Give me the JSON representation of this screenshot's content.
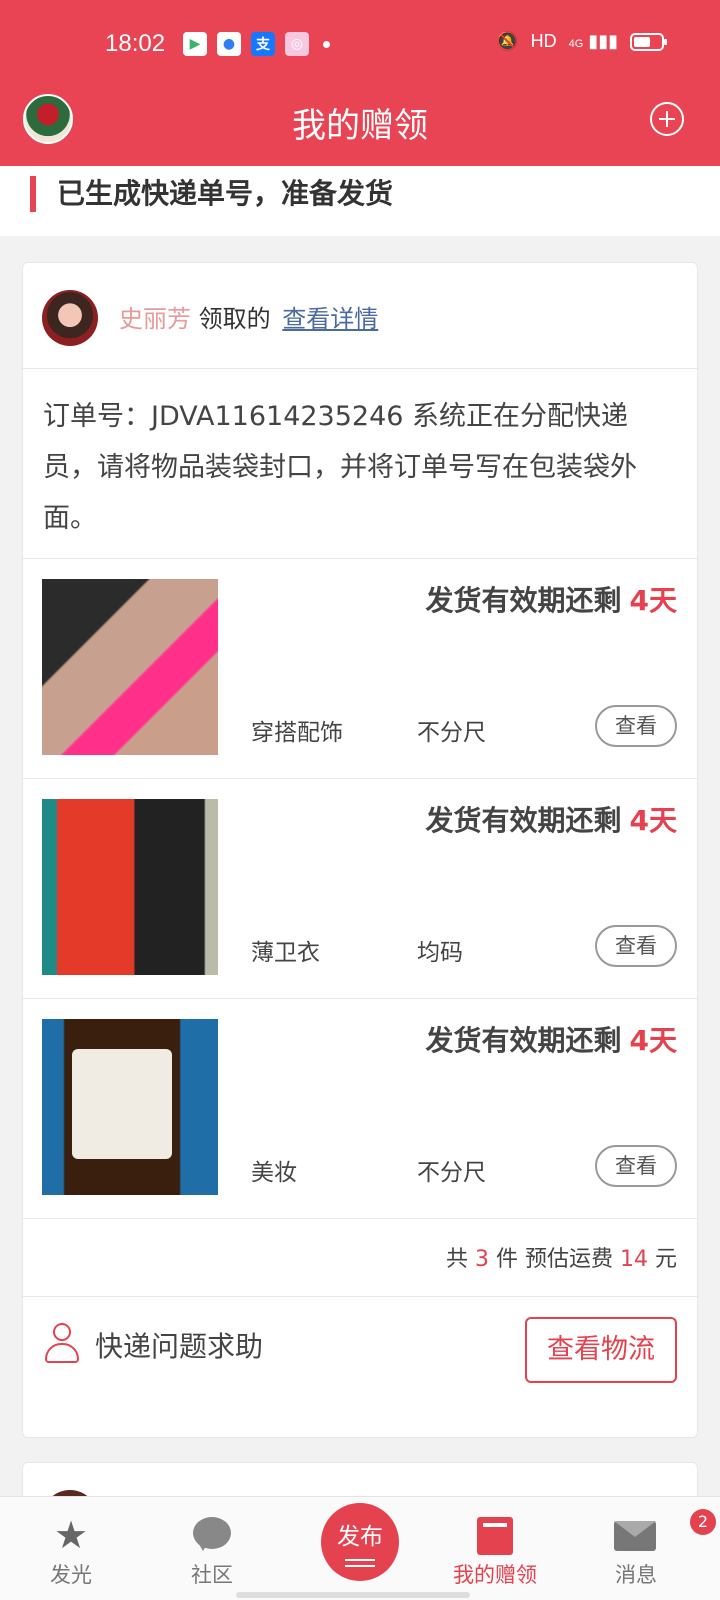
{
  "status_bar": {
    "time": "18:02",
    "network": "HD",
    "signal": "4G"
  },
  "header": {
    "title": "我的赠领"
  },
  "section": {
    "title": "已生成快递单号，准备发货"
  },
  "card": {
    "claimer_name": "史丽芳",
    "claimed_text": "领取的",
    "detail_link": "查看详情",
    "order_message": "订单号：JDVA11614235246 系统正在分配快递员，请将物品装袋封口，并将订单号写在包装袋外面。",
    "items": [
      {
        "expiry_label": "发货有效期还剩",
        "expiry_days": "4天",
        "category": "穿搭配饰",
        "size": "不分尺",
        "view_label": "查看"
      },
      {
        "expiry_label": "发货有效期还剩",
        "expiry_days": "4天",
        "category": "薄卫衣",
        "size": "均码",
        "view_label": "查看"
      },
      {
        "expiry_label": "发货有效期还剩",
        "expiry_days": "4天",
        "category": "美妆",
        "size": "不分尺",
        "view_label": "查看"
      }
    ],
    "summary": {
      "prefix": "共",
      "count": "3",
      "count_unit": "件 预估运费",
      "fee": "14",
      "fee_unit": "元"
    },
    "help_text": "快递问题求助",
    "logistics_button": "查看物流"
  },
  "tabbar": {
    "tabs": [
      {
        "label": "发光"
      },
      {
        "label": "社区"
      },
      {
        "label": "发布"
      },
      {
        "label": "我的赠领"
      },
      {
        "label": "消息"
      }
    ],
    "message_badge": "2"
  },
  "colors": {
    "brand_red": "#e84453",
    "accent_red": "#e5424f"
  }
}
